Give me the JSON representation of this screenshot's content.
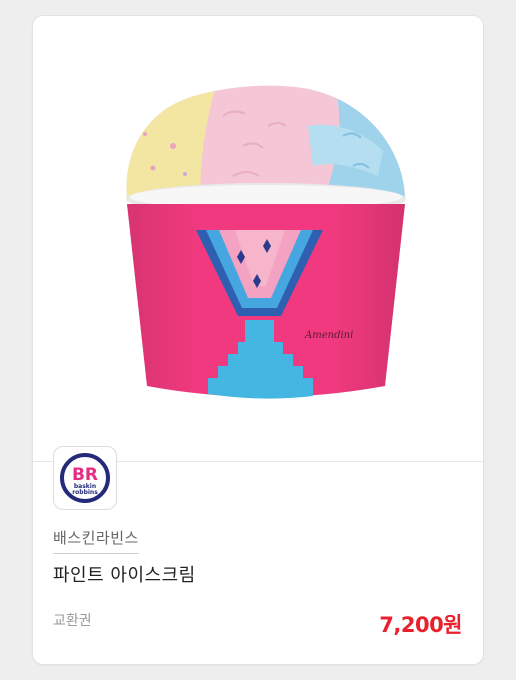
{
  "product": {
    "brand": "배스킨라빈스",
    "name": "파인트 아이스크림",
    "voucher_type": "교환권",
    "price": "7,200원",
    "image_name": "pint-ice-cream-cup-image",
    "cup_signature": "Amendini"
  },
  "logo": {
    "initials": "BR",
    "wordmark_line1": "baskin",
    "wordmark_line2": "robbins",
    "icon": "baskin-robbins-logo-icon"
  },
  "colors": {
    "price": "#e8212c",
    "cup_pink": "#f0397e",
    "cup_blue": "#3fb6e3",
    "logo_navy": "#242a79",
    "logo_pink": "#e62d84"
  }
}
